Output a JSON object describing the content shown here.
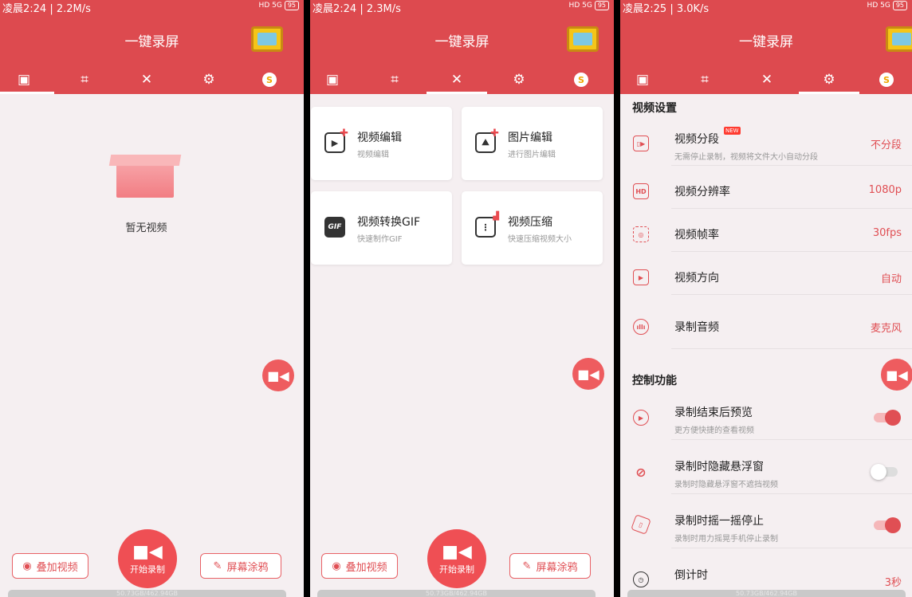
{
  "app_title": "一键录屏",
  "storage_text": "50.73GB/462.94GB",
  "status_right": "HD 5G",
  "battery": "95",
  "panels": [
    {
      "status_time": "凌晨2:24 | 2.2M/s"
    },
    {
      "status_time": "凌晨2:24 | 2.3M/s"
    },
    {
      "status_time": "凌晨2:25 | 3.0K/s"
    }
  ],
  "tab_icons": [
    "video-list-icon",
    "crop-icon",
    "tools-icon",
    "settings-icon",
    "coin-icon"
  ],
  "tab_glyphs": [
    "▣",
    "⌗",
    "✕",
    "⚙",
    "S"
  ],
  "empty_state": {
    "text": "暂无视频"
  },
  "bottom": {
    "overlay_label": "叠加视频",
    "record_label": "开始录制",
    "doodle_label": "屏幕涂鸦"
  },
  "tools": [
    {
      "title": "视频编辑",
      "subtitle": "视频编辑",
      "icon": "video-edit-icon"
    },
    {
      "title": "图片编辑",
      "subtitle": "进行图片编辑",
      "icon": "image-edit-icon"
    },
    {
      "title": "视频转换GIF",
      "subtitle": "快速制作GIF",
      "icon": "gif-icon"
    },
    {
      "title": "视频压缩",
      "subtitle": "快速压缩视频大小",
      "icon": "compress-icon"
    }
  ],
  "settings": {
    "video_section": "视频设置",
    "control_section": "控制功能",
    "new_badge": "NEW",
    "video_items": [
      {
        "title": "视频分段",
        "subtitle": "无需停止录制，视频将文件大小自动分段",
        "value": "不分段",
        "icon_glyph": "▯▶"
      },
      {
        "title": "视频分辨率",
        "subtitle": "",
        "value": "1080p",
        "icon_glyph": "HD"
      },
      {
        "title": "视频帧率",
        "subtitle": "",
        "value": "30fps",
        "icon_glyph": "◎"
      },
      {
        "title": "视频方向",
        "subtitle": "",
        "value": "自动",
        "icon_glyph": "▶"
      },
      {
        "title": "录制音频",
        "subtitle": "",
        "value": "麦克风",
        "icon_glyph": "ıllı"
      }
    ],
    "control_items": [
      {
        "title": "录制结束后预览",
        "subtitle": "更方便快捷的查看视频",
        "toggle": "on",
        "icon_glyph": "▶"
      },
      {
        "title": "录制时隐藏悬浮窗",
        "subtitle": "录制时隐藏悬浮窗不遮挡视频",
        "toggle": "off",
        "icon_glyph": "⊘"
      },
      {
        "title": "录制时摇一摇停止",
        "subtitle": "录制时用力摇晃手机停止录制",
        "toggle": "on",
        "icon_glyph": "▯"
      }
    ],
    "countdown": {
      "title": "倒计时",
      "value": "3秒"
    }
  },
  "colors": {
    "brand": "#dd4a4f",
    "accent": "#e04f54",
    "background": "#f5eff1"
  }
}
